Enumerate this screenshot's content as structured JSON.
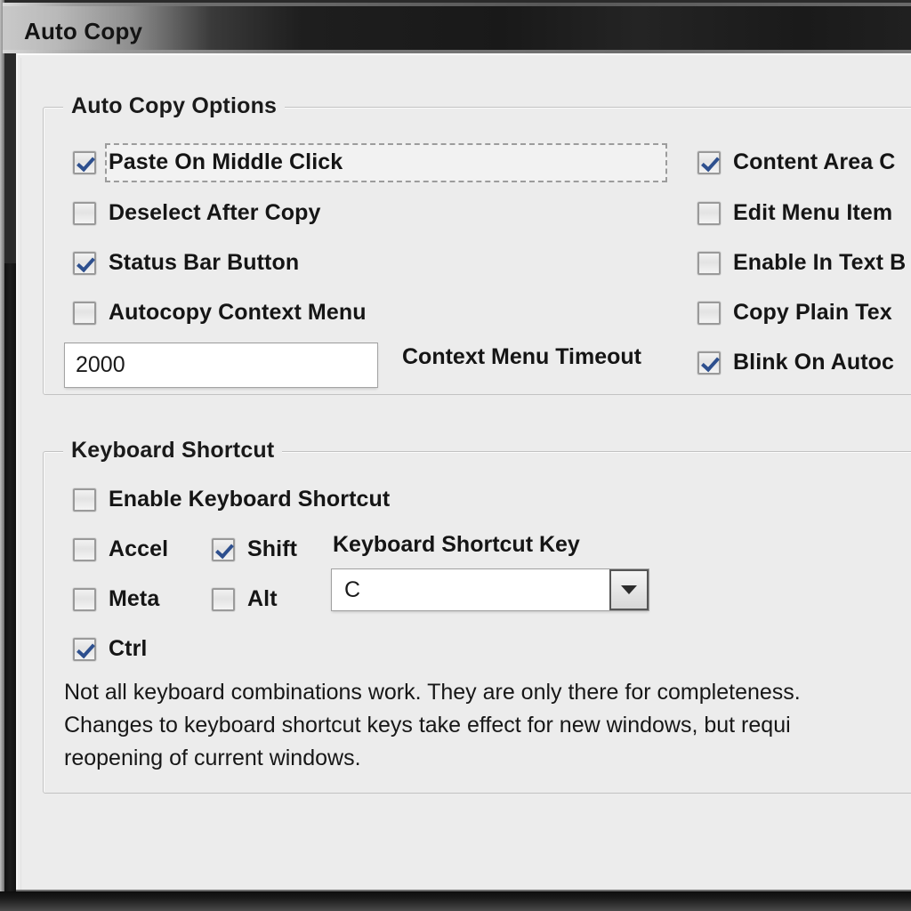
{
  "window": {
    "title": "Auto Copy"
  },
  "options_group": {
    "legend": "Auto Copy Options",
    "left_column": [
      {
        "label": "Paste On Middle Click",
        "checked": true,
        "focused": true
      },
      {
        "label": "Deselect After Copy",
        "checked": false,
        "focused": false
      },
      {
        "label": "Status Bar Button",
        "checked": true,
        "focused": false
      },
      {
        "label": "Autocopy Context Menu",
        "checked": false,
        "focused": false
      }
    ],
    "right_column": [
      {
        "label": "Content Area C",
        "checked": true
      },
      {
        "label": "Edit Menu Item",
        "checked": false
      },
      {
        "label": "Enable In Text B",
        "checked": false
      },
      {
        "label": "Copy Plain Tex",
        "checked": false
      },
      {
        "label": "Blink On Autoc",
        "checked": true
      }
    ],
    "timeout": {
      "value": "2000",
      "label": "Context Menu Timeout"
    }
  },
  "shortcut_group": {
    "legend": "Keyboard Shortcut",
    "enable": {
      "label": "Enable Keyboard Shortcut",
      "checked": false
    },
    "modifiers": [
      {
        "label": "Accel",
        "checked": false
      },
      {
        "label": "Shift",
        "checked": true
      },
      {
        "label": "Meta",
        "checked": false
      },
      {
        "label": "Alt",
        "checked": false
      },
      {
        "label": "Ctrl",
        "checked": true
      }
    ],
    "key_select": {
      "label": "Keyboard Shortcut Key",
      "value": "C",
      "icon": "chevron-down-icon"
    },
    "description": "Not all keyboard combinations work. They are only there for completeness.\nChanges to keyboard shortcut keys take effect for new windows, but requi\nreopening of current windows."
  },
  "colors": {
    "dialog_background": "#ececec",
    "titlebar_dark": "#1c1c1c",
    "check_blue": "#2d4f8e",
    "group_border": "#c2c2c2"
  }
}
